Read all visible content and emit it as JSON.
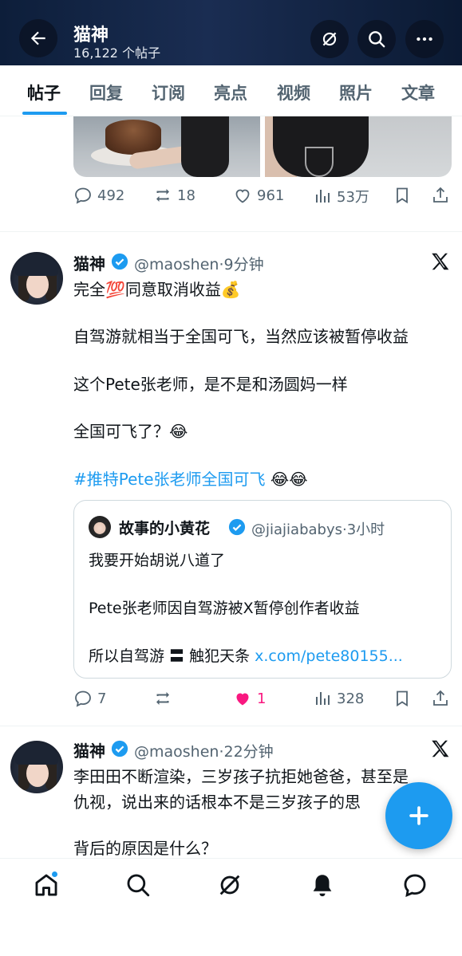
{
  "header": {
    "title": "猫神",
    "subtitle": "16,122 个帖子",
    "icons": [
      "back-arrow-icon",
      "grok-icon",
      "search-icon",
      "more-icon"
    ]
  },
  "tabs": [
    "帖子",
    "回复",
    "订阅",
    "亮点",
    "视频",
    "照片",
    "文章"
  ],
  "post0": {
    "replies": "492",
    "reposts": "18",
    "likes": "961",
    "views": "53万"
  },
  "post1": {
    "name": "猫神",
    "handle": "@maoshen·9分钟",
    "line1": "完全💯同意取消收益💰",
    "line2": "自驾游就相当于全国可飞，当然应该被暂停收益",
    "line3": "这个Pete张老师，是不是和汤圆妈一样",
    "line4": "全国可飞了？😂",
    "hashtag": "#推特Pete张老师全国可飞",
    "hashtag_emoji": " 😂😂",
    "quote": {
      "name": "故事的小黄花",
      "handle": "@jiajiababys·3小时",
      "line1": "我要开始胡说八道了",
      "line2": "Pete张老师因自驾游被X暂停创作者收益",
      "line3": "所以自驾游 〓 触犯天条 ",
      "link": "x.com/pete80155..."
    },
    "replies": "7",
    "likes": "1",
    "views": "328"
  },
  "post2": {
    "name": "猫神",
    "handle": "@maoshen·22分钟",
    "line1": "李田田不断渲染，三岁孩子抗拒她爸爸，甚至是",
    "line2": "仇视，说出来的话根本不是三岁孩子的思",
    "line3": "背后的原因是什么？"
  },
  "bottom_nav": [
    "home-icon",
    "search-icon",
    "grok-icon",
    "notifications-icon",
    "messages-icon"
  ],
  "colors": {
    "accent": "#1d9bf0",
    "like": "#f91880",
    "text": "#0f1419",
    "muted": "#536471"
  }
}
